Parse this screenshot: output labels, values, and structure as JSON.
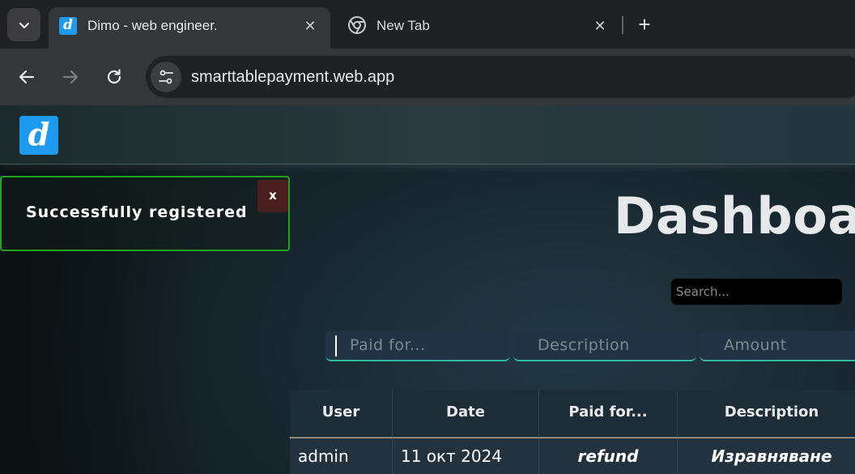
{
  "browser": {
    "tabs": [
      {
        "title": "Dimo - web engineer.",
        "favicon": "d",
        "active": true
      },
      {
        "title": "New Tab",
        "favicon": "chrome-icon",
        "active": false
      }
    ],
    "new_tab_label": "+",
    "close_label": "✕",
    "url": "smarttablepayment.web.app"
  },
  "site": {
    "logo_letter": "d",
    "toast": {
      "message": "Successfully registered",
      "close_label": "x",
      "color": "#21a321"
    },
    "title": "Dashboar",
    "search_placeholder": "Search...",
    "form": {
      "paid_for_placeholder": "Paid for...",
      "description_placeholder": "Description",
      "amount_placeholder": "Amount"
    },
    "table": {
      "headers": [
        "User",
        "Date",
        "Paid for...",
        "Description"
      ],
      "rows": [
        {
          "user": "admin",
          "date": "11 окт 2024",
          "paid_for": "refund",
          "description": "Изравняване"
        }
      ]
    }
  }
}
